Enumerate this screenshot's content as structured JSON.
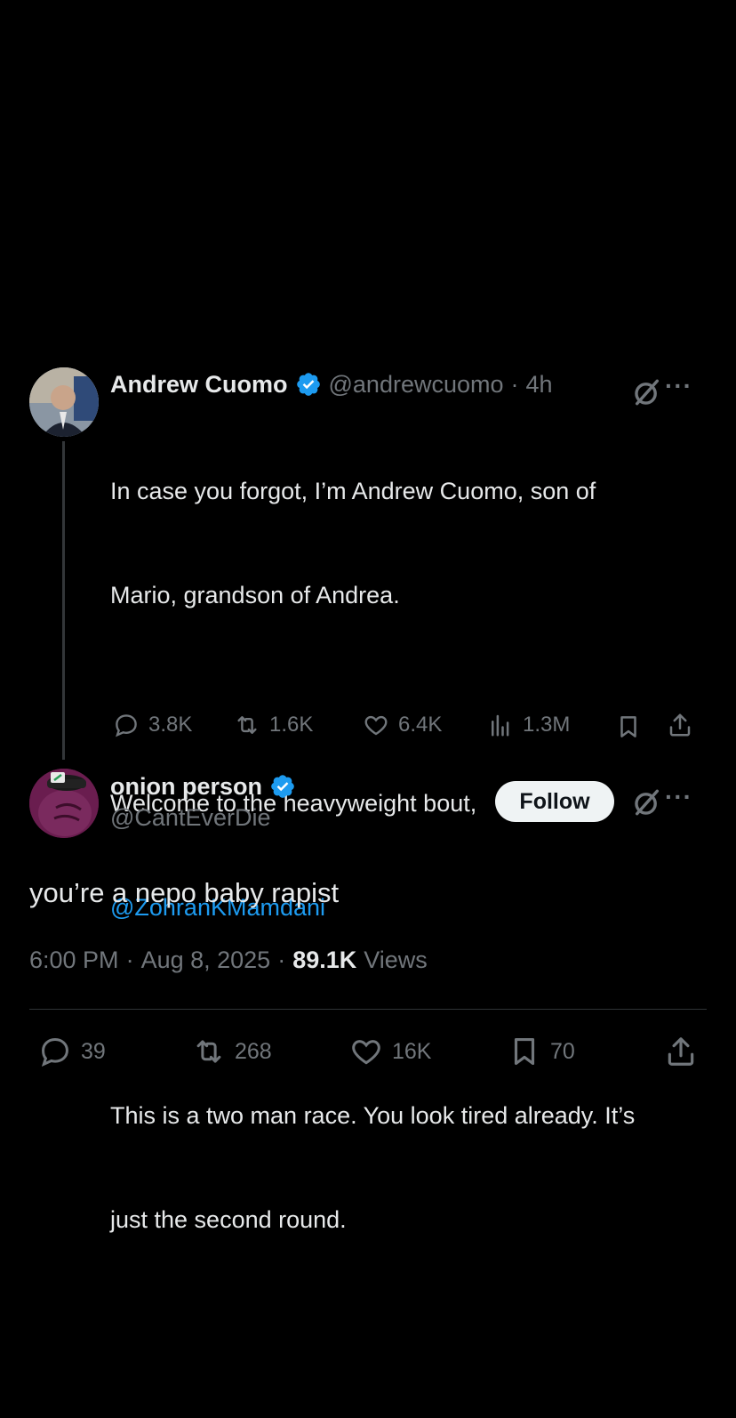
{
  "parent_tweet": {
    "author_name": "Andrew Cuomo",
    "handle": "@andrewcuomo",
    "separator": "·",
    "time_ago": "4h",
    "text_line1": "In case you forgot, I’m Andrew Cuomo, son of",
    "text_line2": "Mario, grandson of Andrea.",
    "text_line3": "Welcome to the heavyweight bout,",
    "mention": "@ZohranKMamdani",
    "text_line4": "This is a two man race. You look tired already. It’s",
    "text_line5": "just the second round.",
    "replies": "3.8K",
    "reposts": "1.6K",
    "likes": "6.4K",
    "views": "1.3M",
    "more_label": "···"
  },
  "reply_tweet": {
    "author_name": "onion person",
    "handle": "@CantEverDie",
    "follow_label": "Follow",
    "more_label": "···",
    "text": "you’re a nepo baby rapist",
    "time": "6:00 PM",
    "separator1": "·",
    "date": "Aug 8, 2025",
    "separator2": "·",
    "view_count": "89.1K",
    "views_label": "Views",
    "replies": "39",
    "reposts": "268",
    "likes": "16K",
    "bookmarks": "70"
  },
  "colors": {
    "background": "#000000",
    "text": "#e7e9ea",
    "muted": "#71767b",
    "link": "#1d9bf0",
    "verified": "#1d9bf0"
  }
}
